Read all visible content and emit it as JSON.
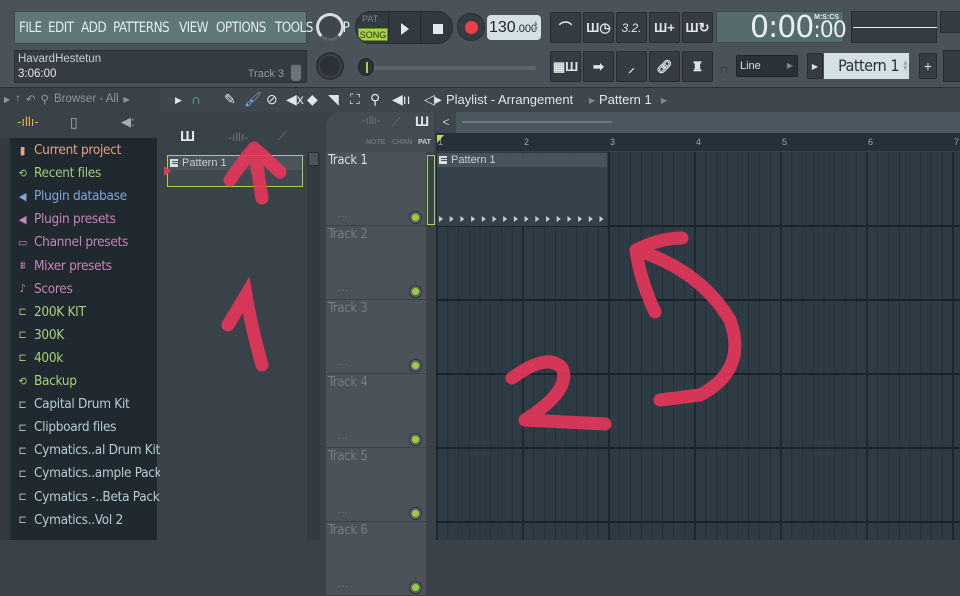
{
  "menu": {
    "items": [
      "FILE",
      "EDIT",
      "ADD",
      "PATTERNS",
      "VIEW",
      "OPTIONS",
      "TOOLS",
      "HELP"
    ]
  },
  "hint_panel": {
    "name": "HavardHestetun",
    "time": "3:06:00",
    "track": "Track 3"
  },
  "transport": {
    "pat_label": "PAT",
    "song_label": "SONG",
    "mode": "SONG",
    "tempo_int": "130",
    "tempo_dec": ".000"
  },
  "clock": {
    "value_main": "0:00",
    "value_cs": ":00",
    "format_label": "M:S:CS"
  },
  "snap": {
    "value": "Line"
  },
  "pattern_selector": {
    "value": "Pattern 1",
    "add_label": "+"
  },
  "toolbar_buttons": {
    "row1": [
      "metronome",
      "wait-for-input",
      "countdown",
      "step-edit",
      "loop-record"
    ],
    "row2": [
      "typing-keyboard",
      "blend-notes",
      "multilink",
      "link-controllers",
      "mixer-knob"
    ]
  },
  "browser": {
    "header": "Browser - All",
    "items": [
      {
        "label": "Current project",
        "icon": "project-icon",
        "color": "#e0a586"
      },
      {
        "label": "Recent files",
        "icon": "recent-folder-icon",
        "color": "#9ccf73"
      },
      {
        "label": "Plugin database",
        "icon": "plugin-icon",
        "color": "#7fa7d6"
      },
      {
        "label": "Plugin presets",
        "icon": "plugin-icon",
        "color": "#c685b6"
      },
      {
        "label": "Channel presets",
        "icon": "channel-icon",
        "color": "#c685b6"
      },
      {
        "label": "Mixer presets",
        "icon": "mixer-icon",
        "color": "#c685b6"
      },
      {
        "label": "Scores",
        "icon": "note-icon",
        "color": "#c685b6"
      },
      {
        "label": "200K KIT",
        "icon": "folder-icon",
        "color": "#a8d27a"
      },
      {
        "label": "300K",
        "icon": "folder-icon",
        "color": "#a8d27a"
      },
      {
        "label": "400k",
        "icon": "folder-icon",
        "color": "#a8d27a"
      },
      {
        "label": "Backup",
        "icon": "recent-folder-icon",
        "color": "#a8d27a"
      },
      {
        "label": "Capital Drum Kit",
        "icon": "folder-icon",
        "color": "#b6ccd4"
      },
      {
        "label": "Clipboard files",
        "icon": "folder-icon",
        "color": "#b6ccd4"
      },
      {
        "label": "Cymatics..al Drum Kit",
        "icon": "folder-icon",
        "color": "#b6ccd4"
      },
      {
        "label": "Cymatics..ample Pack",
        "icon": "folder-icon",
        "color": "#b6ccd4"
      },
      {
        "label": "Cymatics -..Beta Pack",
        "icon": "folder-icon",
        "color": "#b6ccd4"
      },
      {
        "label": "Cymatics..Vol 2",
        "icon": "folder-icon",
        "color": "#b6ccd4"
      }
    ]
  },
  "playlist": {
    "title": "Playlist - Arrangement",
    "breadcrumb_pattern": "Pattern 1",
    "header_labels": {
      "note": "NOTE",
      "chan": "CHAN",
      "pat": "PAT"
    },
    "timeline_ticks": [
      "1",
      "2",
      "3",
      "4",
      "5",
      "6",
      "7"
    ],
    "tracks": [
      "Track 1",
      "Track 2",
      "Track 3",
      "Track 4",
      "Track 5",
      "Track 6"
    ],
    "clip_label": "Pattern 1",
    "picker_pattern": "Pattern 1"
  },
  "annotations": {
    "color": "#e8365a",
    "labels": [
      "1",
      "2"
    ]
  }
}
